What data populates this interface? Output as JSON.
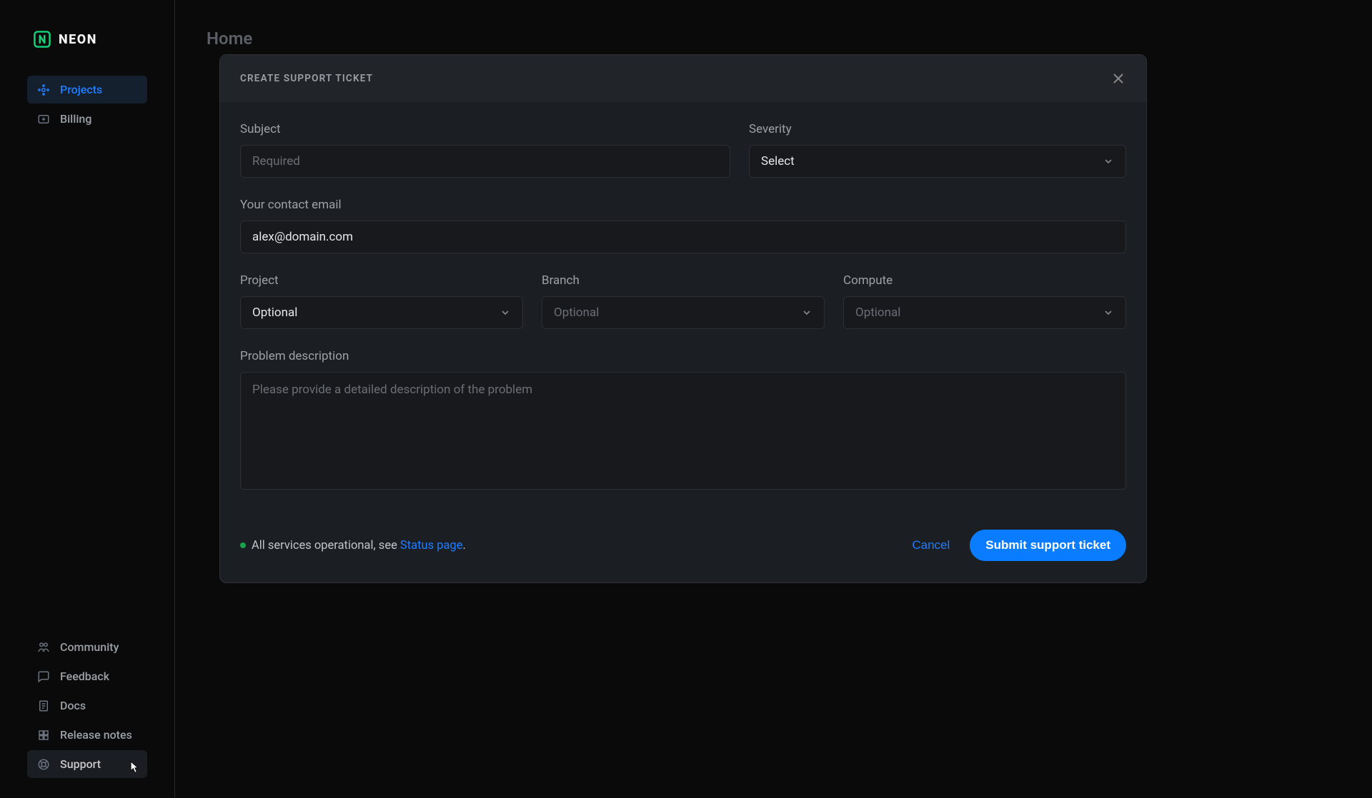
{
  "brand": {
    "name": "NEON"
  },
  "sidebar": {
    "top": [
      {
        "label": "Projects"
      },
      {
        "label": "Billing"
      }
    ],
    "bottom": [
      {
        "label": "Community"
      },
      {
        "label": "Feedback"
      },
      {
        "label": "Docs"
      },
      {
        "label": "Release notes"
      },
      {
        "label": "Support"
      }
    ]
  },
  "page": {
    "title": "Home"
  },
  "modal": {
    "title": "CREATE SUPPORT TICKET",
    "fields": {
      "subject": {
        "label": "Subject",
        "placeholder": "Required",
        "value": ""
      },
      "severity": {
        "label": "Severity",
        "selected": "Select"
      },
      "email": {
        "label": "Your contact email",
        "value": "alex@domain.com"
      },
      "project": {
        "label": "Project",
        "selected": "Optional"
      },
      "branch": {
        "label": "Branch",
        "selected": "Optional"
      },
      "compute": {
        "label": "Compute",
        "selected": "Optional"
      },
      "description": {
        "label": "Problem description",
        "placeholder": "Please provide a detailed description of the problem",
        "value": ""
      }
    },
    "status": {
      "text_before_link": "All services operational, see ",
      "link_text": "Status page",
      "text_after_link": "."
    },
    "actions": {
      "cancel": "Cancel",
      "submit": "Submit support ticket"
    }
  }
}
